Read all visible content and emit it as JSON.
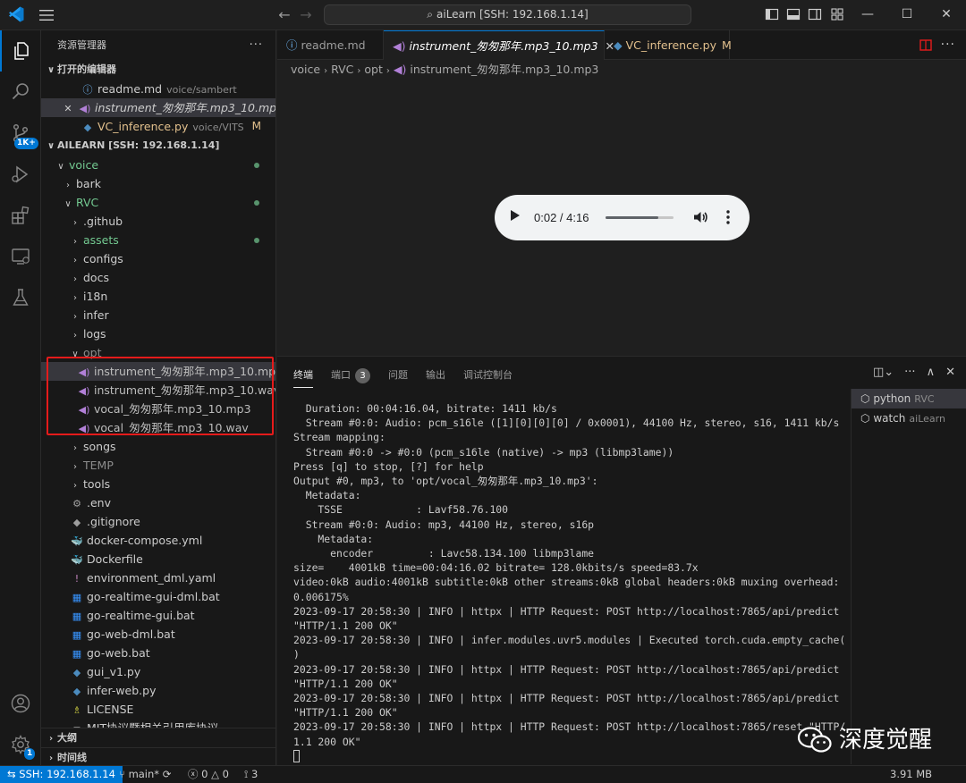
{
  "titlebar": {
    "search_text": "aiLearn [SSH: 192.168.1.14]"
  },
  "activity": {
    "scm_badge": "1K+",
    "settings_badge": "1"
  },
  "sidebar": {
    "header": "资源管理器",
    "open_editors_title": "打开的编辑器",
    "open_editors": [
      {
        "name": "readme.md",
        "desc": "voice/sambert",
        "icon": "info-icon"
      },
      {
        "name": "instrument_匆匆那年.mp3_10.mp3",
        "desc": "",
        "icon": "audio-icon"
      },
      {
        "name": "VC_inference.py",
        "desc": "voice/VITS",
        "flag": "M",
        "icon": "python-icon"
      }
    ],
    "workspace_title": "AILEARN [SSH: 192.168.1.14]",
    "tree": [
      {
        "label": "voice",
        "indent": 0,
        "chev": "open"
      },
      {
        "label": "bark",
        "indent": 1,
        "chev": "closed"
      },
      {
        "label": "RVC",
        "indent": 1,
        "chev": "open"
      },
      {
        "label": ".github",
        "indent": 2,
        "chev": "closed"
      },
      {
        "label": "assets",
        "indent": 2,
        "chev": "closed"
      },
      {
        "label": "configs",
        "indent": 2,
        "chev": "closed"
      },
      {
        "label": "docs",
        "indent": 2,
        "chev": "closed"
      },
      {
        "label": "i18n",
        "indent": 2,
        "chev": "closed"
      },
      {
        "label": "infer",
        "indent": 2,
        "chev": "closed"
      },
      {
        "label": "logs",
        "indent": 2,
        "chev": "closed"
      },
      {
        "label": "opt",
        "indent": 2,
        "chev": "open"
      },
      {
        "label": "instrument_匆匆那年.mp3_10.mp3",
        "indent": 3,
        "file": "audio"
      },
      {
        "label": "instrument_匆匆那年.mp3_10.wav",
        "indent": 3,
        "file": "audio"
      },
      {
        "label": "vocal_匆匆那年.mp3_10.mp3",
        "indent": 3,
        "file": "audio"
      },
      {
        "label": "vocal_匆匆那年.mp3_10.wav",
        "indent": 3,
        "file": "audio"
      },
      {
        "label": "songs",
        "indent": 2,
        "chev": "closed"
      },
      {
        "label": "TEMP",
        "indent": 2,
        "chev": "closed"
      },
      {
        "label": "tools",
        "indent": 2,
        "chev": "closed"
      },
      {
        "label": ".env",
        "indent": 2,
        "file": "gear"
      },
      {
        "label": ".gitignore",
        "indent": 2,
        "file": "git"
      },
      {
        "label": "docker-compose.yml",
        "indent": 2,
        "file": "docker"
      },
      {
        "label": "Dockerfile",
        "indent": 2,
        "file": "docker"
      },
      {
        "label": "environment_dml.yaml",
        "indent": 2,
        "file": "yml"
      },
      {
        "label": "go-realtime-gui-dml.bat",
        "indent": 2,
        "file": "win"
      },
      {
        "label": "go-realtime-gui.bat",
        "indent": 2,
        "file": "win"
      },
      {
        "label": "go-web-dml.bat",
        "indent": 2,
        "file": "win"
      },
      {
        "label": "go-web.bat",
        "indent": 2,
        "file": "win"
      },
      {
        "label": "gui_v1.py",
        "indent": 2,
        "file": "py"
      },
      {
        "label": "infer-web.py",
        "indent": 2,
        "file": "py"
      },
      {
        "label": "LICENSE",
        "indent": 2,
        "file": "license"
      },
      {
        "label": "MIT协议暨相关引用库协议",
        "indent": 2,
        "file": "doc"
      }
    ],
    "outline_title": "大纲",
    "timeline_title": "时间线"
  },
  "tabs": [
    {
      "label": "readme.md",
      "icon": "info-icon"
    },
    {
      "label": "instrument_匆匆那年.mp3_10.mp3",
      "icon": "audio-icon",
      "active": true
    },
    {
      "label": "VC_inference.py",
      "icon": "python-icon",
      "flag": "M"
    }
  ],
  "breadcrumb": [
    "voice",
    "RVC",
    "opt",
    "instrument_匆匆那年.mp3_10.mp3"
  ],
  "audio_player": {
    "time": "0:02 / 4:16",
    "progress": 0.78
  },
  "panel": {
    "tabs": [
      "终端",
      "端口",
      "问题",
      "输出",
      "调试控制台"
    ],
    "ports_count": "3",
    "terminal_lines": [
      "  Duration: 00:04:16.04, bitrate: 1411 kb/s",
      "  Stream #0:0: Audio: pcm_s16le ([1][0][0][0] / 0x0001), 44100 Hz, stereo, s16, 1411 kb/s",
      "Stream mapping:",
      "  Stream #0:0 -> #0:0 (pcm_s16le (native) -> mp3 (libmp3lame))",
      "Press [q] to stop, [?] for help",
      "Output #0, mp3, to 'opt/vocal_匆匆那年.mp3_10.mp3':",
      "  Metadata:",
      "    TSSE            : Lavf58.76.100",
      "  Stream #0:0: Audio: mp3, 44100 Hz, stereo, s16p",
      "    Metadata:",
      "      encoder         : Lavc58.134.100 libmp3lame",
      "size=    4001kB time=00:04:16.02 bitrate= 128.0kbits/s speed=83.7x",
      "video:0kB audio:4001kB subtitle:0kB other streams:0kB global headers:0kB muxing overhead:",
      "0.006175%",
      "2023-09-17 20:58:30 | INFO | httpx | HTTP Request: POST http://localhost:7865/api/predict",
      "\"HTTP/1.1 200 OK\"",
      "2023-09-17 20:58:30 | INFO | infer.modules.uvr5.modules | Executed torch.cuda.empty_cache(",
      ")",
      "2023-09-17 20:58:30 | INFO | httpx | HTTP Request: POST http://localhost:7865/api/predict",
      "\"HTTP/1.1 200 OK\"",
      "2023-09-17 20:58:30 | INFO | httpx | HTTP Request: POST http://localhost:7865/api/predict",
      "\"HTTP/1.1 200 OK\"",
      "2023-09-17 20:58:30 | INFO | httpx | HTTP Request: POST http://localhost:7865/reset \"HTTP/",
      "1.1 200 OK\""
    ],
    "terminals": [
      {
        "name": "python",
        "desc": "RVC"
      },
      {
        "name": "watch",
        "desc": "aiLearn"
      }
    ]
  },
  "statusbar": {
    "remote": "SSH: 192.168.1.14",
    "branch": "main*",
    "errors": "0",
    "warnings": "0",
    "ports": "3",
    "memory": "3.91 MB"
  },
  "watermark": {
    "text": "深度觉醒"
  },
  "colors": {
    "accent": "#0078d4",
    "highlight_box": "#e51b1b",
    "git_added": "#73c991",
    "modified": "#e2c08d",
    "audio_icon": "#b180d7"
  }
}
